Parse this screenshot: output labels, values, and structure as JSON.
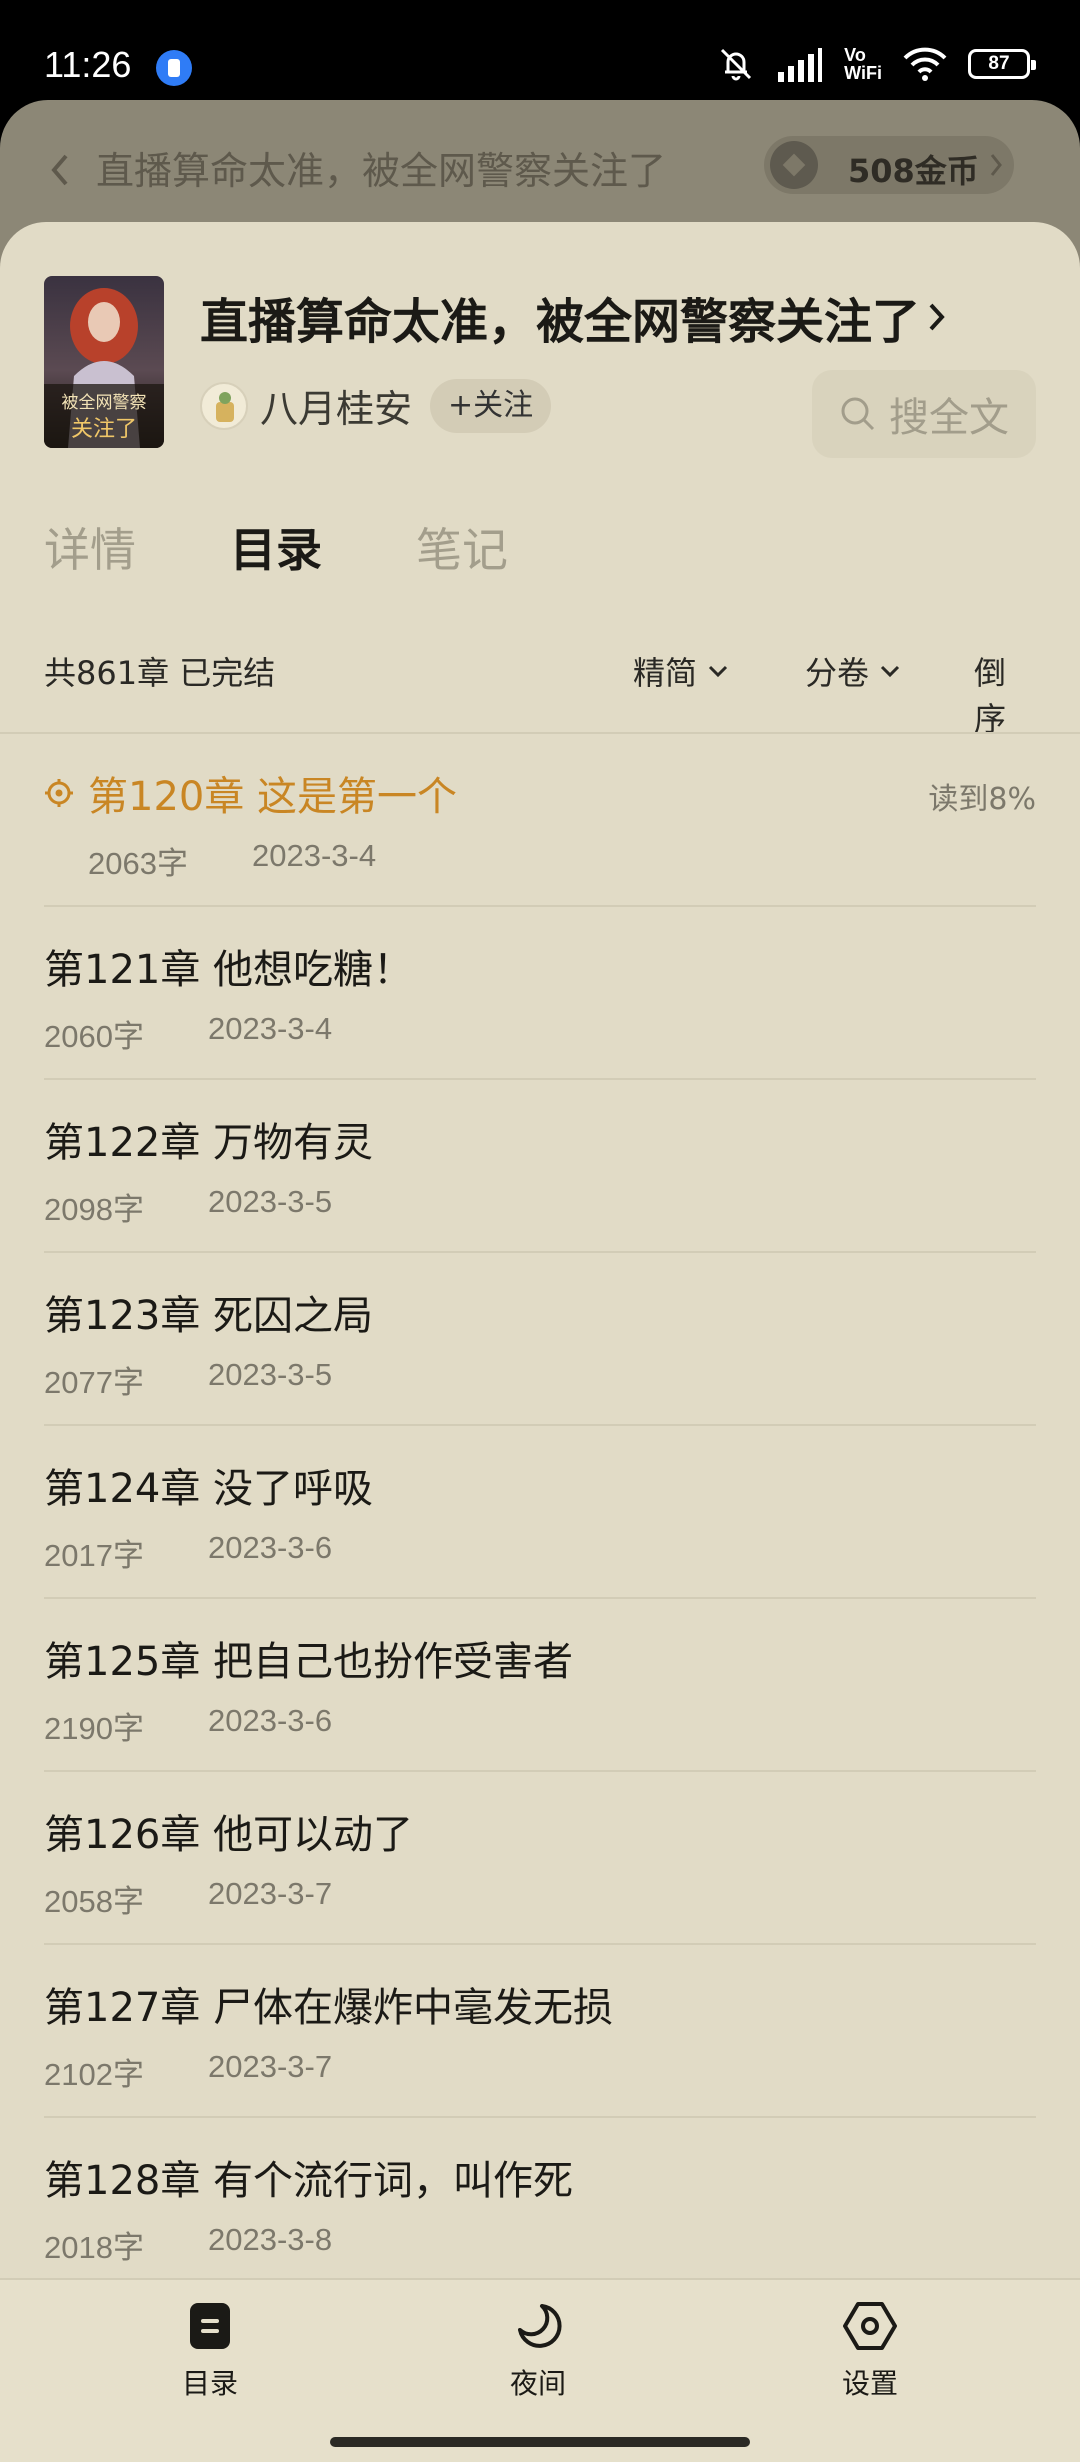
{
  "status_bar": {
    "time": "11:26",
    "vowifi_top": "Vo",
    "vowifi_bottom": "WiFi",
    "battery": "87"
  },
  "background_page": {
    "title": "直播算命太准，被全网警察关注了",
    "coins": "508金币"
  },
  "book": {
    "title": "直播算命太准，被全网警察关注了",
    "cover_text_top": "被全网警察",
    "cover_text_bottom": "关注了",
    "author": "八月桂安",
    "follow_label": "+关注",
    "search_placeholder": "搜全文"
  },
  "tabs": [
    {
      "label": "详情",
      "active": false
    },
    {
      "label": "目录",
      "active": true
    },
    {
      "label": "笔记",
      "active": false
    }
  ],
  "catalog_meta": {
    "summary": "共861章 已完结",
    "filter_simplified": "精简",
    "filter_volume": "分卷",
    "sort_label": "倒序"
  },
  "chapters": [
    {
      "title": "第120章 这是第一个",
      "words": "2063字",
      "date": "2023-3-4",
      "current": true,
      "progress": "读到8%"
    },
    {
      "title": "第121章 他想吃糖！",
      "words": "2060字",
      "date": "2023-3-4"
    },
    {
      "title": "第122章 万物有灵",
      "words": "2098字",
      "date": "2023-3-5"
    },
    {
      "title": "第123章 死囚之局",
      "words": "2077字",
      "date": "2023-3-5"
    },
    {
      "title": "第124章 没了呼吸",
      "words": "2017字",
      "date": "2023-3-6"
    },
    {
      "title": "第125章 把自己也扮作受害者",
      "words": "2190字",
      "date": "2023-3-6"
    },
    {
      "title": "第126章 他可以动了",
      "words": "2058字",
      "date": "2023-3-7"
    },
    {
      "title": "第127章 尸体在爆炸中毫发无损",
      "words": "2102字",
      "date": "2023-3-7"
    },
    {
      "title": "第128章 有个流行词，叫作死",
      "words": "2018字",
      "date": "2023-3-8"
    }
  ],
  "bottom_nav": [
    {
      "label": "目录",
      "icon": "catalog-icon"
    },
    {
      "label": "夜间",
      "icon": "moon-icon"
    },
    {
      "label": "设置",
      "icon": "settings-hexagon-icon"
    }
  ],
  "colors": {
    "sheet_bg": "#e1dbc6",
    "accent_current": "#c98624",
    "text_primary": "#1b1a16",
    "text_secondary": "#7c786b"
  }
}
